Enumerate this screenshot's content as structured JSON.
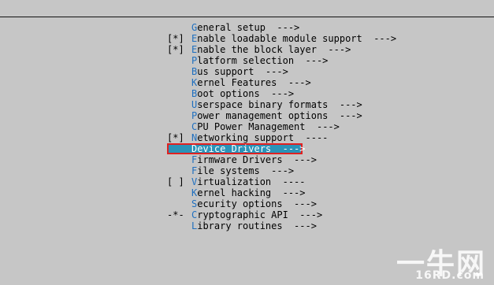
{
  "menu": {
    "items": [
      {
        "mark": "",
        "hot": "G",
        "rest": "eneral setup",
        "arrow": "  --->"
      },
      {
        "mark": "[*]",
        "hot": "E",
        "rest": "nable loadable module support",
        "arrow": "  --->"
      },
      {
        "mark": "[*]",
        "hot": "E",
        "rest": "nable the block layer",
        "arrow": "  --->"
      },
      {
        "mark": "",
        "hot": "P",
        "rest": "latform selection",
        "arrow": "  --->"
      },
      {
        "mark": "",
        "hot": "B",
        "rest": "us support",
        "arrow": "  --->"
      },
      {
        "mark": "",
        "hot": "K",
        "rest": "ernel Features",
        "arrow": "  --->"
      },
      {
        "mark": "",
        "hot": "B",
        "rest": "oot options",
        "arrow": "  --->"
      },
      {
        "mark": "",
        "hot": "U",
        "rest": "serspace binary formats",
        "arrow": "  --->"
      },
      {
        "mark": "",
        "hot": "P",
        "rest": "ower management options",
        "arrow": "  --->"
      },
      {
        "mark": "",
        "hot": "C",
        "rest": "PU Power Management",
        "arrow": "  --->"
      },
      {
        "mark": "[*]",
        "hot": "N",
        "rest": "etworking support",
        "arrow": "  ----"
      },
      {
        "mark": "",
        "hot": "D",
        "rest": "evice Drivers",
        "arrow": "  --->",
        "selected": true
      },
      {
        "mark": "",
        "hot": "F",
        "rest": "irmware Drivers",
        "arrow": "  --->"
      },
      {
        "mark": "",
        "hot": "F",
        "rest": "ile systems",
        "arrow": "  --->"
      },
      {
        "mark": "[ ]",
        "hot": "V",
        "rest": "irtualization",
        "arrow": "  ----"
      },
      {
        "mark": "",
        "hot": "K",
        "rest": "ernel hacking",
        "arrow": "  --->"
      },
      {
        "mark": "",
        "hot": "S",
        "rest": "ecurity options",
        "arrow": "  --->"
      },
      {
        "mark": "-*-",
        "hot": "C",
        "rest": "ryptographic API",
        "arrow": "  --->"
      },
      {
        "mark": "",
        "hot": "L",
        "rest": "ibrary routines",
        "arrow": "  --->"
      }
    ]
  },
  "watermark": {
    "main": "一牛网",
    "sub": "16RD.com"
  },
  "colors": {
    "background": "#c6c6c6",
    "hotkey": "#1f6fbf",
    "selection": "#2a93b8",
    "highlight_border": "#e02020"
  }
}
